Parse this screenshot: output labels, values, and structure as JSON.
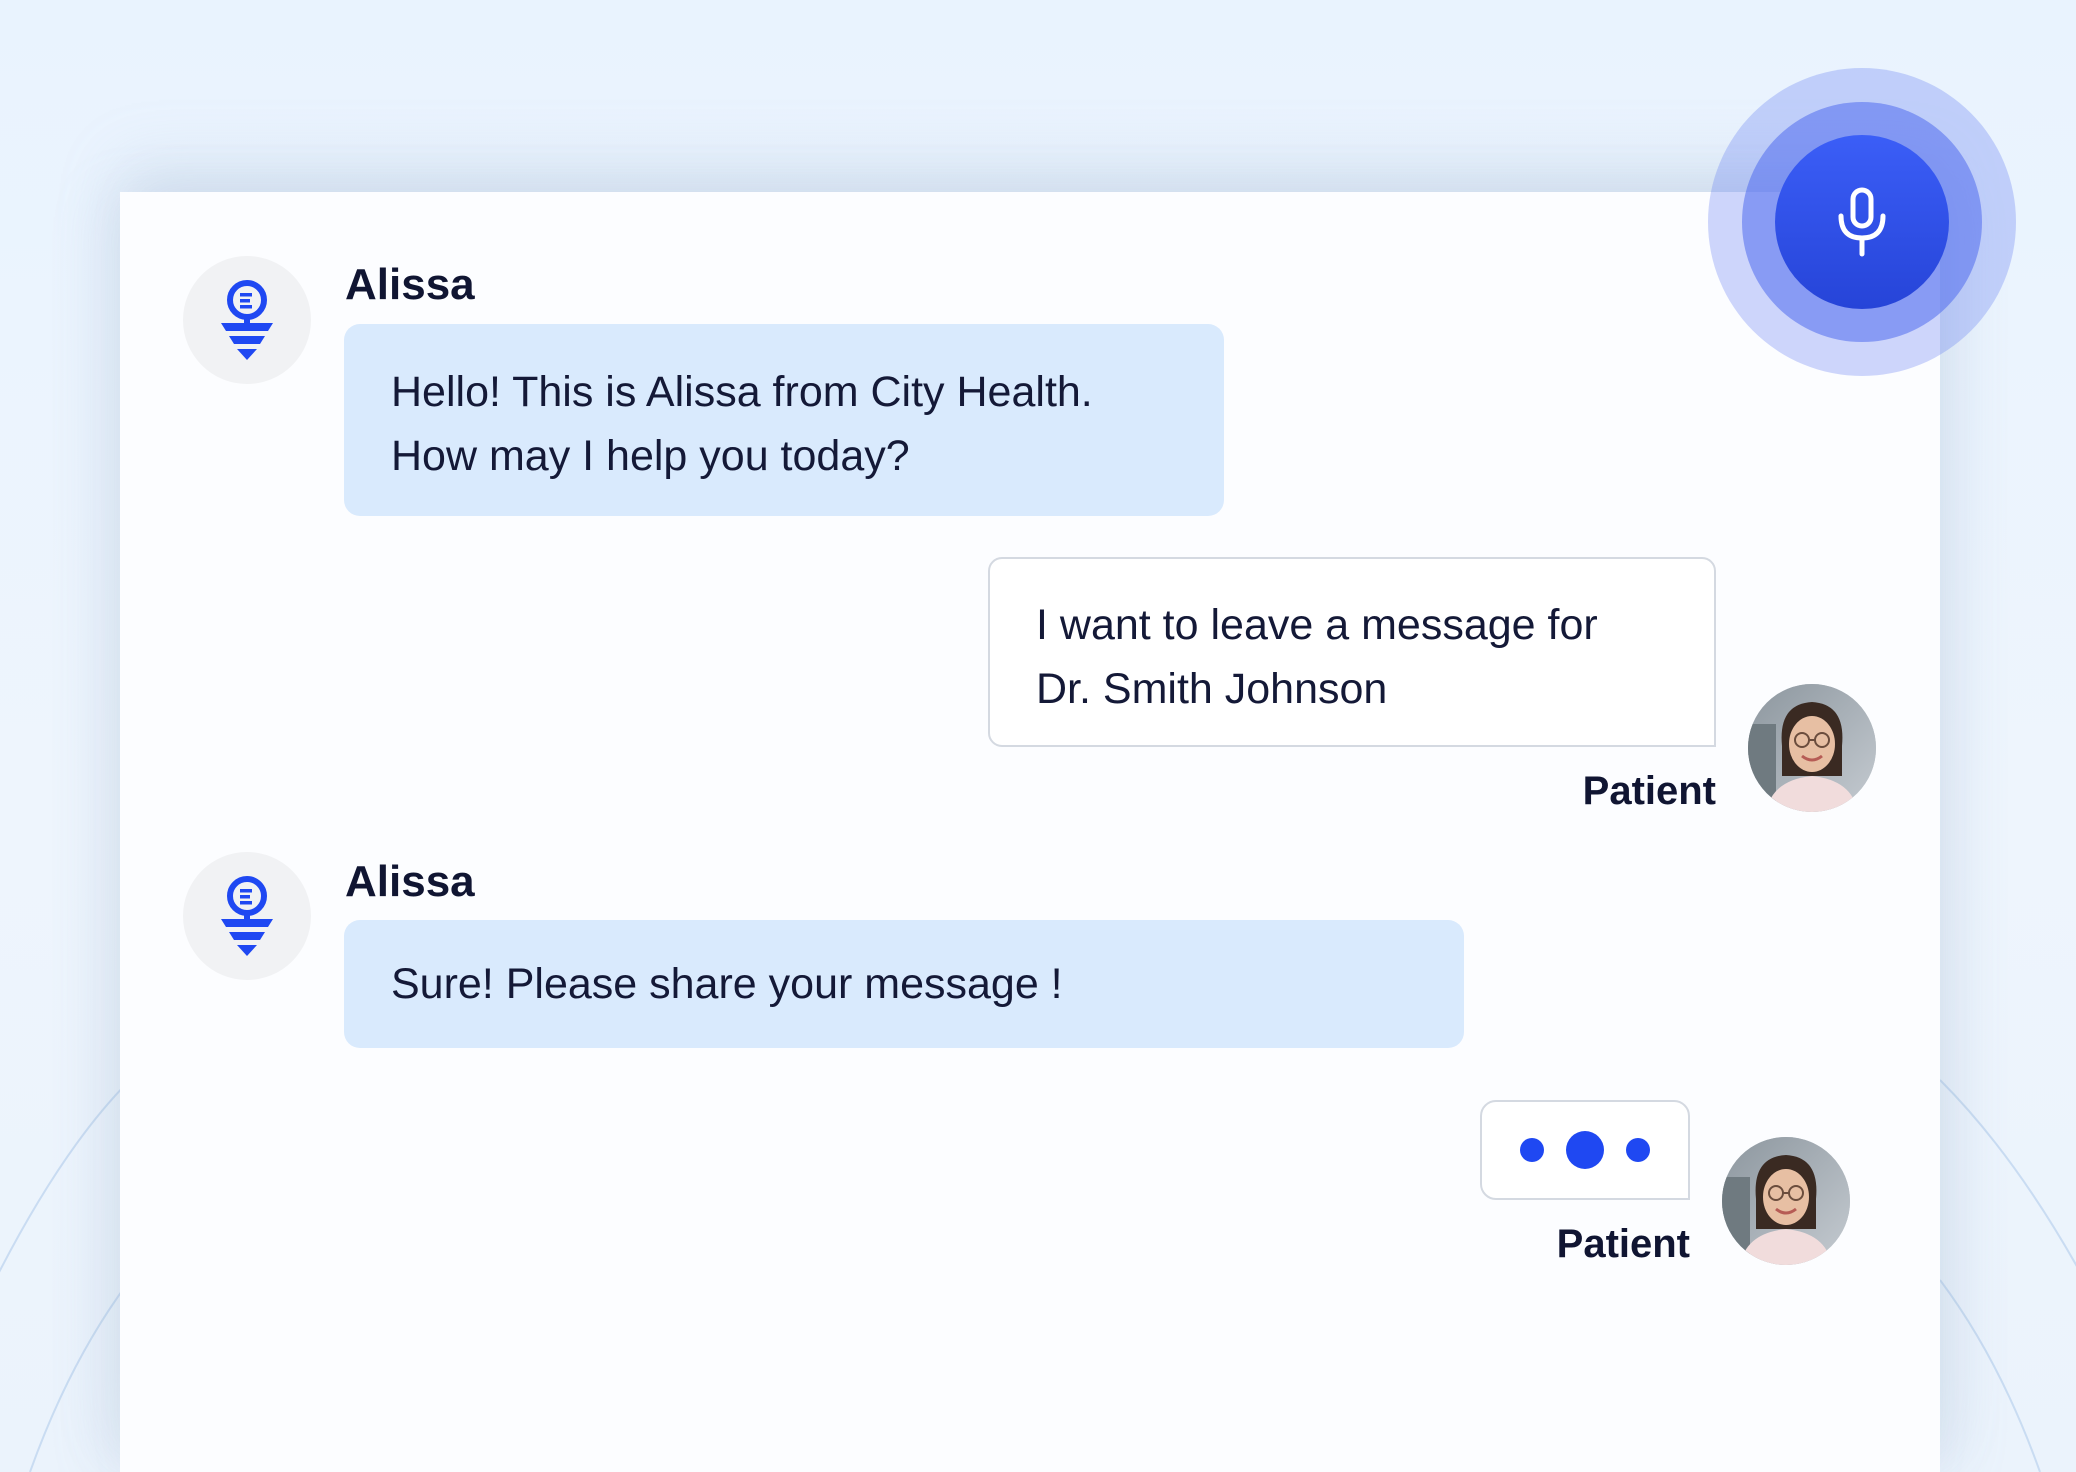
{
  "colors": {
    "accent": "#1f48f2",
    "agent_bubble": "#d9eafd",
    "text": "#141937"
  },
  "mic": {
    "icon": "microphone-icon"
  },
  "messages": [
    {
      "sender": "Alissa",
      "role": "agent",
      "lines": [
        "Hello! This is Alissa from City Health.",
        "How may I help you today?"
      ]
    },
    {
      "sender": "Patient",
      "role": "user",
      "lines": [
        "I want to leave a message for",
        "Dr. Smith Johnson"
      ]
    },
    {
      "sender": "Alissa",
      "role": "agent",
      "lines": [
        "Sure! Please share your message !"
      ]
    },
    {
      "sender": "Patient",
      "role": "user",
      "typing": true
    }
  ]
}
